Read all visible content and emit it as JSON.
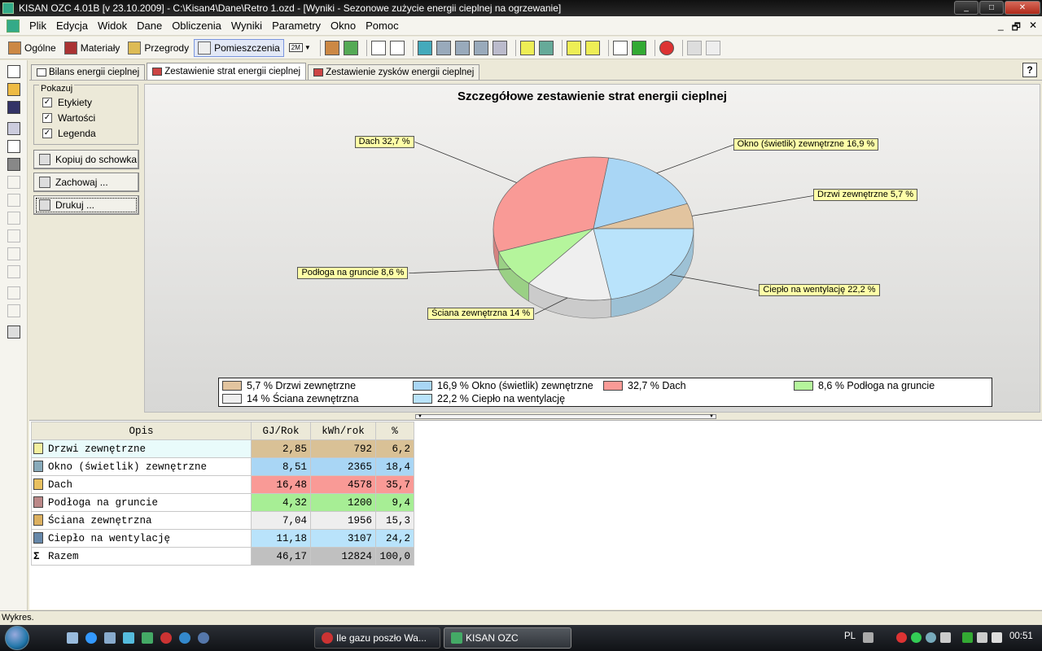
{
  "window": {
    "title": "KISAN OZC 4.01B [v 23.10.2009] - C:\\Kisan4\\Dane\\Retro 1.ozd - [Wyniki - Sezonowe zużycie energii cieplnej na ogrzewanie]",
    "btn_min": "_",
    "btn_max": "□",
    "btn_close": "✕"
  },
  "menu": {
    "items": [
      "Plik",
      "Edycja",
      "Widok",
      "Dane",
      "Obliczenia",
      "Wyniki",
      "Parametry",
      "Okno",
      "Pomoc"
    ],
    "mdi_min": "_",
    "mdi_restore": "🗗",
    "mdi_close": "✕"
  },
  "toolbar": {
    "buttons": [
      "Ogólne",
      "Materiały",
      "Przegrody",
      "Pomieszczenia"
    ],
    "active": "Pomieszczenia",
    "zoom_label": "2M"
  },
  "tabs": [
    "Bilans energii cieplnej",
    "Zestawienie strat energii cieplnej",
    "Zestawienie zysków energii cieplnej"
  ],
  "active_tab": "Zestawienie strat energii cieplnej",
  "help_label": "?",
  "options": {
    "group_label": "Pokazuj",
    "checkboxes": [
      {
        "label": "Etykiety",
        "checked": true
      },
      {
        "label": "Wartości",
        "checked": true
      },
      {
        "label": "Legenda",
        "checked": true
      }
    ],
    "check_mark": "✓"
  },
  "side_buttons": {
    "copy": "Kopiuj do schowka",
    "save": "Zachowaj ...",
    "print": "Drukuj ..."
  },
  "chart_data": {
    "type": "pie",
    "title": "Szczegółowe zestawienie strat energii cieplnej",
    "slices": [
      {
        "label": "Drzwi zewnętrzne",
        "value": 5.7,
        "color": "#e2c49f",
        "callout": "Drzwi zewnętrzne 5,7 %",
        "legend": "5,7 % Drzwi zewnętrzne"
      },
      {
        "label": "Okno (świetlik) zewnętrzne",
        "value": 16.9,
        "color": "#a9d6f5",
        "callout": "Okno (świetlik) zewnętrzne 16,9 %",
        "legend": "16,9 % Okno (świetlik) zewnętrzne"
      },
      {
        "label": "Dach",
        "value": 32.7,
        "color": "#f99a96",
        "callout": "Dach 32,7 %",
        "legend": "32,7 % Dach"
      },
      {
        "label": "Podłoga na gruncie",
        "value": 8.6,
        "color": "#b5f59c",
        "callout": "Podłoga na gruncie 8,6 %",
        "legend": "8,6 % Podłoga na gruncie"
      },
      {
        "label": "Ściana zewnętrzna",
        "value": 14,
        "color": "#efefef",
        "callout": "Ściana zewnętrzna 14 %",
        "legend": "14 % Ściana zewnętrzna"
      },
      {
        "label": "Ciepło na wentylację",
        "value": 22.2,
        "color": "#b9e3fb",
        "callout": "Ciepło na wentylację 22,2 %",
        "legend": "22,2 % Ciepło na wentylację"
      }
    ],
    "legend_position": "bottom",
    "style": "3d"
  },
  "table": {
    "headers": [
      "Opis",
      "GJ/Rok",
      "kWh/rok",
      "%"
    ],
    "rows": [
      {
        "opis": "Drzwi zewnętrzne",
        "gj": "2,85",
        "kwh": "792",
        "pct": "6,2",
        "color": "#d9c196",
        "icon_color": "#f3f0a0"
      },
      {
        "opis": "Okno (świetlik) zewnętrzne",
        "gj": "8,51",
        "kwh": "2365",
        "pct": "18,4",
        "color": "#a9d6f5",
        "icon_color": "#8ab"
      },
      {
        "opis": "Dach",
        "gj": "16,48",
        "kwh": "4578",
        "pct": "35,7",
        "color": "#f99a96",
        "icon_color": "#e8c060"
      },
      {
        "opis": "Podłoga na gruncie",
        "gj": "4,32",
        "kwh": "1200",
        "pct": "9,4",
        "color": "#a7ee95",
        "icon_color": "#b88"
      },
      {
        "opis": "Ściana zewnętrzna",
        "gj": "7,04",
        "kwh": "1956",
        "pct": "15,3",
        "color": "#eeeeee",
        "icon_color": "#dcb060"
      },
      {
        "opis": "Ciepło na wentylację",
        "gj": "11,18",
        "kwh": "3107",
        "pct": "24,2",
        "color": "#b9e3fb",
        "icon_color": "#68a"
      },
      {
        "opis": "Razem",
        "gj": "46,17",
        "kwh": "12824",
        "pct": "100,0",
        "color": "#c0c0c0",
        "icon_color": "#fff"
      }
    ],
    "total_symbol": "Σ"
  },
  "status": "Wykres.",
  "taskbar": {
    "tasks": [
      "Ile gazu poszło Wa...",
      "KISAN OZC"
    ],
    "language": "PL",
    "clock": "00:51"
  }
}
